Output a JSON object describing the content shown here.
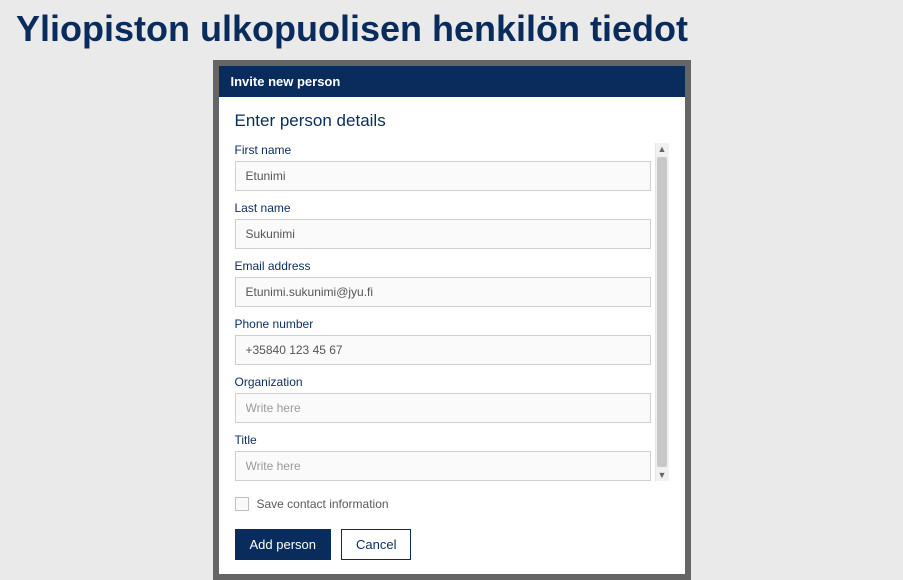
{
  "page": {
    "title": "Yliopiston ulkopuolisen henkilön tiedot"
  },
  "dialog": {
    "header": "Invite new person",
    "subtitle": "Enter person details",
    "fields": {
      "first_name": {
        "label": "First name",
        "value": "Etunimi"
      },
      "last_name": {
        "label": "Last name",
        "value": "Sukunimi"
      },
      "email": {
        "label": "Email address",
        "value": "Etunimi.sukunimi@jyu.fi"
      },
      "phone": {
        "label": "Phone number",
        "value": "+35840 123 45 67"
      },
      "organization": {
        "label": "Organization",
        "placeholder": "Write here"
      },
      "title": {
        "label": "Title",
        "placeholder": "Write here"
      }
    },
    "checkbox": {
      "save_contact": "Save contact information",
      "checked": false
    },
    "buttons": {
      "add": "Add person",
      "cancel": "Cancel"
    }
  }
}
